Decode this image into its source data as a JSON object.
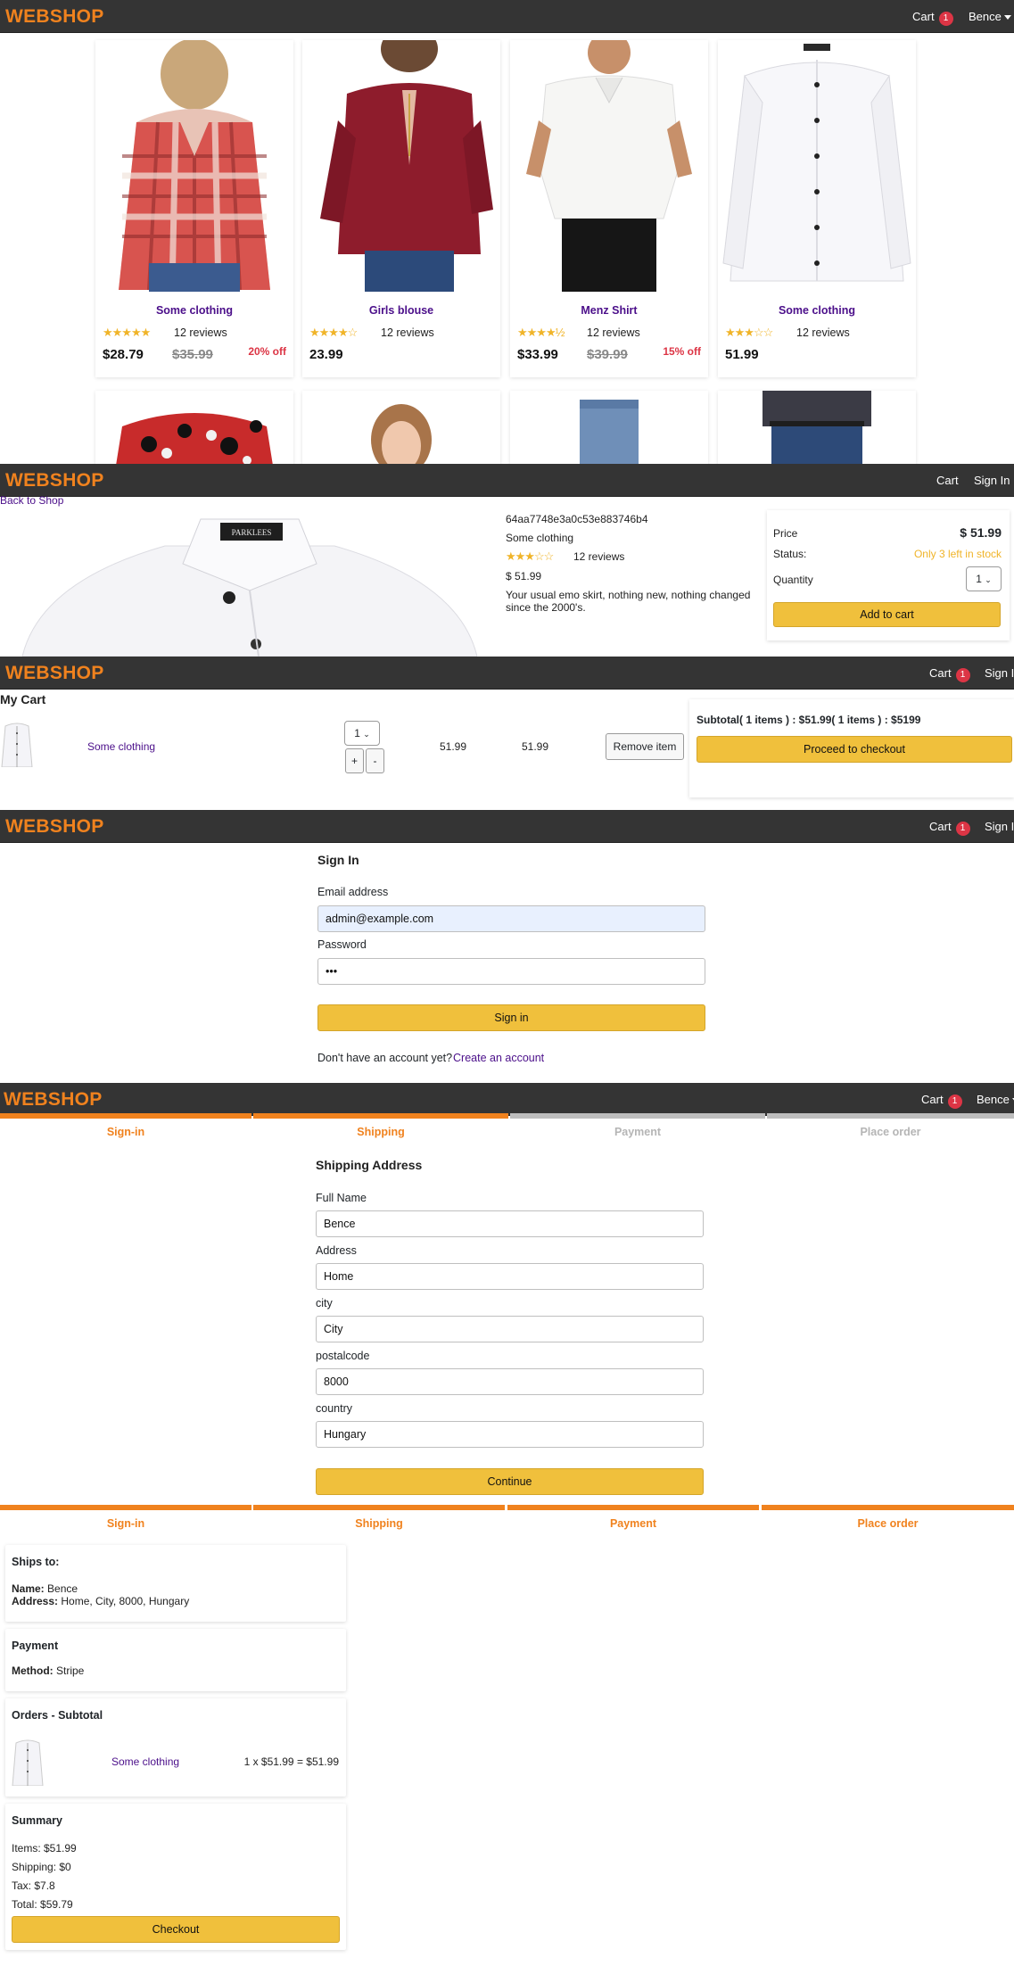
{
  "brand": "WEBSHOP",
  "screens": {
    "home": {
      "cart_label": "Cart",
      "cart_count": "1",
      "user_label": "Bence",
      "products": [
        {
          "name": "Some clothing",
          "stars": "★★★★★",
          "reviews": "12 reviews",
          "price": "$28.79",
          "old_price": "$35.99",
          "discount": "20% off"
        },
        {
          "name": "Girls blouse",
          "stars": "★★★★☆",
          "reviews": "12 reviews",
          "price": "23.99",
          "old_price": "",
          "discount": ""
        },
        {
          "name": "Menz Shirt",
          "stars": "★★★★½",
          "reviews": "12 reviews",
          "price": "$33.99",
          "old_price": "$39.99",
          "discount": "15% off"
        },
        {
          "name": "Some clothing",
          "stars": "★★★☆☆",
          "reviews": "12 reviews",
          "price": "51.99",
          "old_price": "",
          "discount": ""
        }
      ]
    },
    "detail": {
      "cart_label": "Cart",
      "signin_label": "Sign In",
      "back_link": "Back to Shop",
      "product_id": "64aa7748e3a0c53e883746b4",
      "name": "Some clothing",
      "stars": "★★★☆☆",
      "reviews": "12 reviews",
      "price": "$ 51.99",
      "description": "Your usual emo skirt, nothing new, nothing changed since the 2000's.",
      "price_label": "Price",
      "price_value": "$ 51.99",
      "status_label": "Status:",
      "status_value": "Only 3 left in stock",
      "quantity_label": "Quantity",
      "quantity_value": "1",
      "add_to_cart": "Add to cart",
      "photo_tag": "PARKLEES"
    },
    "cart": {
      "cart_label": "Cart",
      "cart_count": "1",
      "signin_label": "Sign I",
      "title": "My Cart",
      "item_name": "Some clothing",
      "qty": "1",
      "plus": "+",
      "minus": "-",
      "unit_price": "51.99",
      "total_price": "51.99",
      "remove": "Remove item",
      "subtotal": "Subtotal( 1 items ) : $51.99( 1 items ) : $5199",
      "checkout": "Proceed to checkout"
    },
    "signin": {
      "cart_label": "Cart",
      "cart_count": "1",
      "signin_label": "Sign I",
      "title": "Sign In",
      "email_label": "Email address",
      "email_value": "admin@example.com",
      "password_label": "Password",
      "password_value": "•••",
      "button": "Sign in",
      "no_account": "Don't have an account yet?",
      "create_link": "Create an account"
    },
    "shipping": {
      "cart_label": "Cart",
      "cart_count": "1",
      "user_label": "Bence",
      "steps": [
        "Sign-in",
        "Shipping",
        "Payment",
        "Place order"
      ],
      "title": "Shipping Address",
      "fullname_label": "Full Name",
      "fullname_value": "Bence",
      "address_label": "Address",
      "address_value": "Home",
      "city_label": "city",
      "city_value": "City",
      "postal_label": "postalcode",
      "postal_value": "8000",
      "country_label": "country",
      "country_value": "Hungary",
      "continue": "Continue"
    },
    "placeorder": {
      "steps": [
        "Sign-in",
        "Shipping",
        "Payment",
        "Place order"
      ],
      "ships_title": "Ships to:",
      "name_key": "Name:",
      "name_value": "Bence",
      "address_key": "Address:",
      "address_value": "Home, City, 8000, Hungary",
      "payment_title": "Payment",
      "method_key": "Method:",
      "method_value": "Stripe",
      "orders_title": "Orders - Subtotal",
      "order_item": "Some clothing",
      "order_calc": "1 x $51.99 = $51.99",
      "summary_title": "Summary",
      "items": "Items: $51.99",
      "shipping": "Shipping: $0",
      "tax": "Tax: $7.8",
      "total": "Total: $59.79",
      "checkout": "Checkout"
    }
  },
  "colors": {
    "navbar": "#343434",
    "brand": "#f0821e",
    "accent_button": "#f0c03c",
    "link": "#4b0f8a",
    "badge": "#dc3545",
    "step_active": "#f0821e",
    "step_inactive": "#bdbdbd"
  }
}
